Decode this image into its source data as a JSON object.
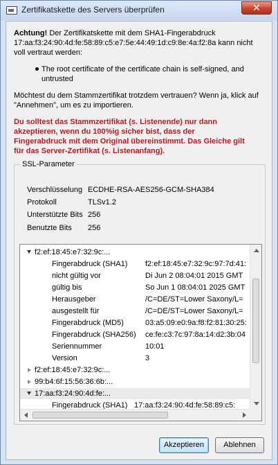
{
  "window": {
    "title": "Zertifikatskette des Servers überprüfen",
    "close_glyph": "✕"
  },
  "intro": {
    "bold": "Achtung!",
    "rest_line1": " Der Zertifikatskette mit dem SHA1-Fingerabdruck",
    "line2": "17:aa:f3:24:90:4d:fe:58:89:c5:e7:5e:44:49:1d:c9:8e:4a:f2:8a kann nicht",
    "line3": "voll vertraut werden:"
  },
  "bullet": {
    "line1": "The root certificate of the certificate chain is self-signed, and",
    "line2": "untrusted"
  },
  "question": {
    "line1": "Möchtest du dem Stammzertifikat trotzdem vertrauen? Wenn ja, klick auf",
    "line2": "\"Annehmen\", um es zu importieren."
  },
  "warning": {
    "line1": "Du solltest das Stammzertifikat (s. Listenende) nur dann",
    "line2": "akzeptieren, wenn du 100%ig sicher bist, dass der",
    "line3": "Fingerabdruck mit dem Original übereinstimmt. Das Gleiche gilt",
    "line4": "für das Server-Zertifikat (s. Listenanfang)."
  },
  "ssl": {
    "legend": "SSL-Parameter",
    "rows": [
      {
        "k": "Verschlüsselung",
        "v": "ECDHE-RSA-AES256-GCM-SHA384"
      },
      {
        "k": "Protokoll",
        "v": "TLSv1.2"
      },
      {
        "k": "Unterstützte Bits",
        "v": "256"
      },
      {
        "k": "Benutzte Bits",
        "v": "256"
      }
    ]
  },
  "tree": {
    "node1": "f2:ef:18:45:e7:32:9c:...",
    "node1_fields": [
      {
        "k": "Fingerabdruck (SHA1)",
        "v": "f2:ef:18:45:e7:32:9c:97:7d:41:"
      },
      {
        "k": "nicht gültig vor",
        "v": "Di Jun 2 08:04:01 2015 GMT"
      },
      {
        "k": "gültig bis",
        "v": "So Jun 1 08:04:01 2025 GMT"
      },
      {
        "k": "Herausgeber",
        "v": "/C=DE/ST=Lower Saxony/L="
      },
      {
        "k": "ausgestellt für",
        "v": "/C=DE/ST=Lower Saxony/L="
      },
      {
        "k": "Fingerabdruck (MD5)",
        "v": "03:a5:09:e0:9a:f8:f2:81:30:25:"
      },
      {
        "k": "Fingerabdruck (SHA256)",
        "v": "ce:fe:c3:7c:97:8a:14:d2:3b:04"
      },
      {
        "k": "Seriennummer",
        "v": "10:01"
      },
      {
        "k": "Version",
        "v": "3"
      }
    ],
    "node2": "f2:ef:18:45:e7:32:9c:...",
    "node3": "99:b4:6f:15:56:36:6b:...",
    "node4": "17:aa:f3:24:90:4d:fe:...",
    "node4_field": {
      "k": "Fingerabdruck (SHA1)",
      "v": "17:aa:f3:24:90:4d:fe:58:89:c5:"
    }
  },
  "buttons": {
    "accept": "Akzeptieren",
    "reject": "Ablehnen"
  }
}
